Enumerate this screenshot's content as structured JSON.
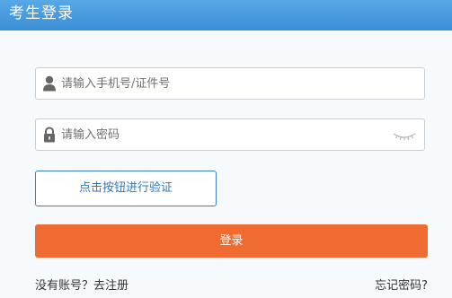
{
  "header": {
    "title": "考生登录"
  },
  "form": {
    "phone_placeholder": "请输入手机号/证件号",
    "password_placeholder": "请输入密码",
    "verify_button_label": "点击按钮进行验证",
    "login_button_label": "登录"
  },
  "footer": {
    "no_account_text": "没有账号？",
    "register_link": "去注册",
    "forgot_password_link": "忘记密码?"
  },
  "icons": {
    "phone_field_icon": "user-icon",
    "password_field_icon": "lock-icon",
    "password_toggle_icon": "eye-closed-icon"
  },
  "colors": {
    "header_blue": "#3c8fd6",
    "login_orange": "#ef6b31",
    "verify_border": "#3b82c4"
  }
}
